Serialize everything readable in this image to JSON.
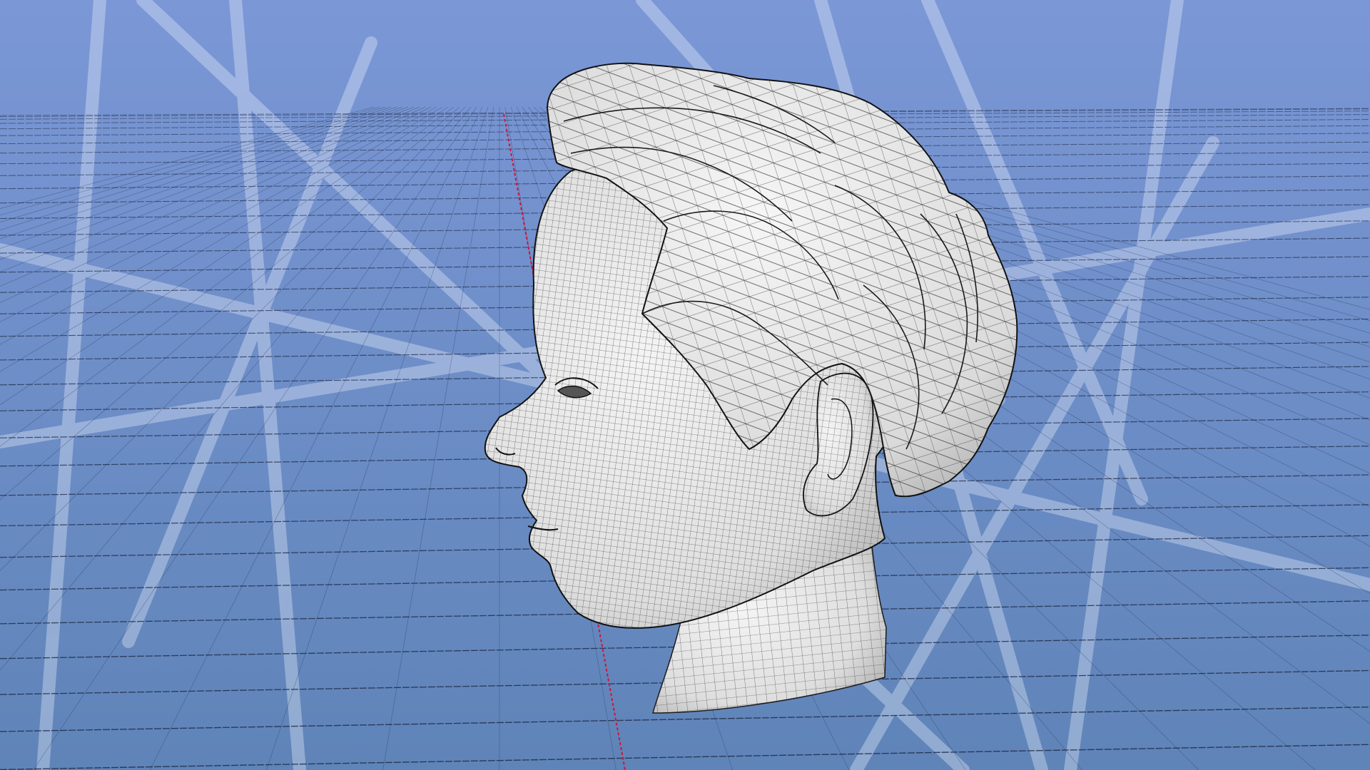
{
  "viewport": {
    "background_top": "#7b97d6",
    "background_bottom": "#5f84b8",
    "grid_color": "#1a2540",
    "axis_color": "#d0143a",
    "reflection_color": "#eef3ff",
    "mesh_fill": "#ededed",
    "mesh_shadow": "#b8b8b8",
    "mesh_wire": "#1c1c1c",
    "grid_visible": true,
    "axis_visible": true,
    "shading_mode": "wireframe-over-solid"
  },
  "scene": {
    "model": "head-bust",
    "view_direction": "left-side-three-quarter"
  }
}
